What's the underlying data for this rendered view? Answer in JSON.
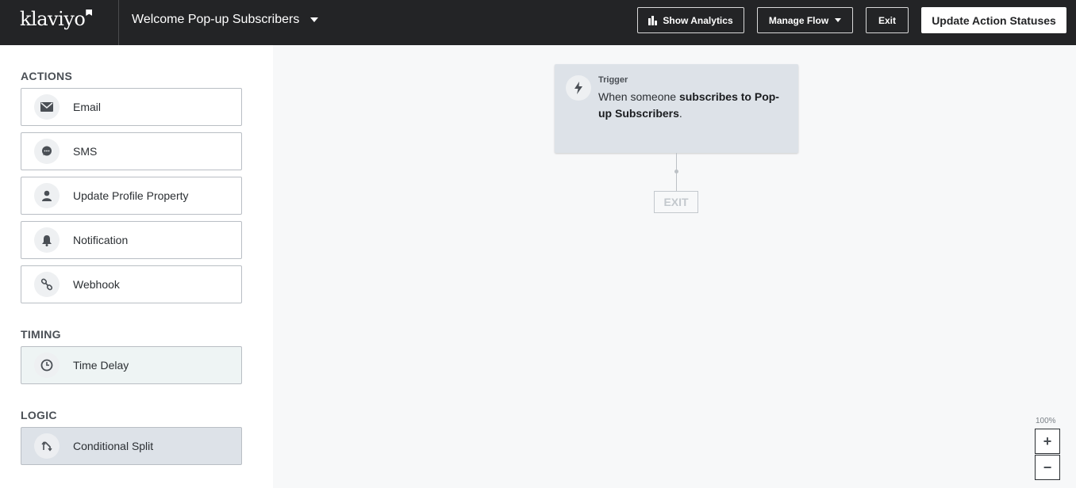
{
  "header": {
    "logo": "klaviyo",
    "flow_title": "Welcome Pop-up Subscribers",
    "buttons": {
      "analytics": "Show Analytics",
      "manage": "Manage Flow",
      "exit": "Exit",
      "update": "Update Action Statuses"
    }
  },
  "sidebar": {
    "actions_label": "ACTIONS",
    "actions": [
      {
        "label": "Email",
        "icon": "envelope-icon"
      },
      {
        "label": "SMS",
        "icon": "chat-bubble-icon"
      },
      {
        "label": "Update Profile Property",
        "icon": "person-icon"
      },
      {
        "label": "Notification",
        "icon": "bell-icon"
      },
      {
        "label": "Webhook",
        "icon": "link-icon"
      }
    ],
    "timing_label": "TIMING",
    "timing": [
      {
        "label": "Time Delay",
        "icon": "clock-icon"
      }
    ],
    "logic_label": "LOGIC",
    "logic": [
      {
        "label": "Conditional Split",
        "icon": "split-arrow-icon"
      }
    ]
  },
  "canvas": {
    "trigger": {
      "label": "Trigger",
      "text_before": "When someone ",
      "text_bold": "subscribes to Pop-up Subscribers",
      "text_after": "."
    },
    "exit_label": "EXIT",
    "zoom": {
      "level": "100%",
      "zoom_in": "+",
      "zoom_out": "−"
    }
  },
  "colors": {
    "topbar": "#232426",
    "trigger_bg": "#dde2e8",
    "timing_bg": "#eef4f4",
    "logic_bg": "#dde2e8"
  }
}
